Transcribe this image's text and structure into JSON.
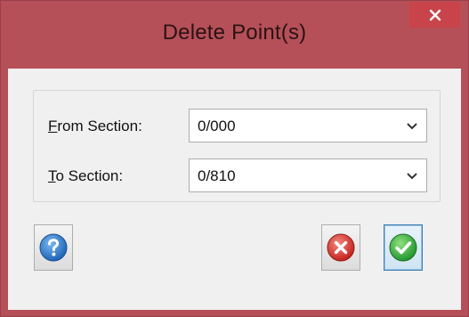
{
  "window": {
    "title": "Delete Point(s)",
    "close_symbol": "×"
  },
  "form": {
    "from_section": {
      "label_accel": "F",
      "label_rest": "rom Section:",
      "value": "0/000"
    },
    "to_section": {
      "label_accel": "T",
      "label_rest": "o Section:",
      "value": "0/810"
    }
  },
  "buttons": {
    "help": {
      "icon": "help-question-icon"
    },
    "cancel": {
      "icon": "cancel-x-icon"
    },
    "ok": {
      "icon": "ok-check-icon"
    }
  },
  "colors": {
    "title_bar": "#b55058",
    "close_button": "#c9434b",
    "help_blue": "#2a7bd0",
    "cancel_red": "#d9302b",
    "ok_green": "#2eae3a"
  }
}
